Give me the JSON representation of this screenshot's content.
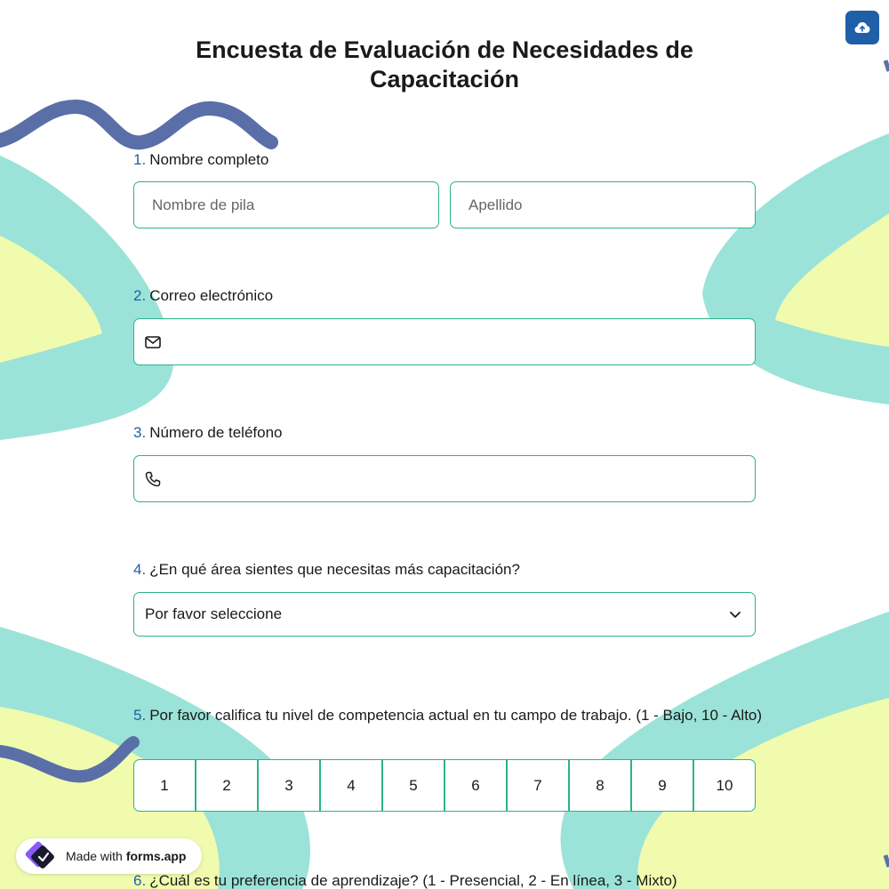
{
  "form": {
    "title": "Encuesta de Evaluación de Necesidades de Capacitación"
  },
  "questions": [
    {
      "number": "1.",
      "text": "Nombre completo"
    },
    {
      "number": "2.",
      "text": "Correo electrónico"
    },
    {
      "number": "3.",
      "text": "Número de teléfono"
    },
    {
      "number": "4.",
      "text": "¿En qué área sientes que necesitas más capacitación?"
    },
    {
      "number": "5.",
      "text": "Por favor califica tu nivel de competencia actual en tu campo de trabajo. (1 - Bajo, 10 - Alto)"
    },
    {
      "number": "6.",
      "text": "¿Cuál es tu preferencia de aprendizaje? (1 - Presencial, 2 - En línea, 3 - Mixto)"
    }
  ],
  "fields": {
    "first_name_placeholder": "Nombre de pila",
    "last_name_placeholder": "Apellido",
    "email_value": "",
    "phone_value": "",
    "area_select_value": "Por favor seleccione"
  },
  "rating": {
    "options": [
      "1",
      "2",
      "3",
      "4",
      "5",
      "6",
      "7",
      "8",
      "9",
      "10"
    ]
  },
  "badge": {
    "prefix": "Made with",
    "brand": "forms.app"
  },
  "icons": {
    "upload": "cloud-upload-icon",
    "email": "envelope-icon",
    "phone": "phone-icon",
    "select": "chevron-down-icon",
    "brand": "forms-app-logo"
  },
  "colors": {
    "accent": "#1f5fa8",
    "border": "#2bb38a",
    "teal_shape": "#9be3d8",
    "yellow_shape": "#f1fbae",
    "squiggle": "#5a6fa8"
  }
}
